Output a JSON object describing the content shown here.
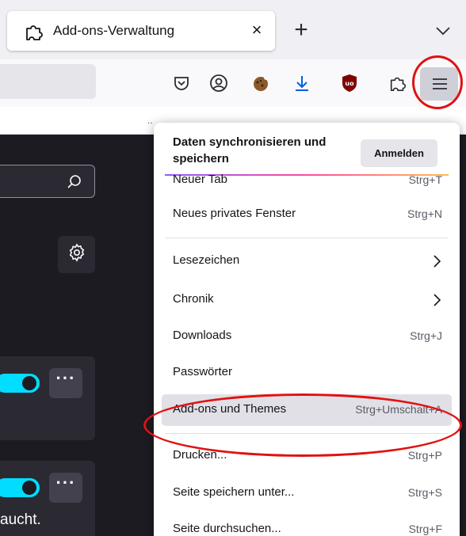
{
  "tab": {
    "title": "Add-ons-Verwaltung",
    "icon": "puzzle-piece-icon",
    "close_symbol": "×"
  },
  "new_tab_symbol": "+",
  "toolbar": {
    "icons": [
      "pocket-icon",
      "account-icon",
      "cookie-extension-icon",
      "downloads-arrow-icon",
      "ublock-shield-icon",
      "extensions-puzzle-icon",
      "hamburger-menu-icon"
    ],
    "bookmarks_overflow": ".."
  },
  "content": {
    "search_icon": "search-icon",
    "gear_icon": "gear-icon",
    "card1": {
      "more": "···"
    },
    "card2": {
      "more": "···",
      "text": "aucht."
    }
  },
  "menu": {
    "sync_title": "Daten synchronisieren und speichern",
    "signin_label": "Anmelden",
    "items": [
      {
        "label": "Neuer Tab",
        "shortcut": "Strg+T"
      },
      {
        "label": "Neues privates Fenster",
        "shortcut": "Strg+N"
      },
      {
        "label": "Lesezeichen",
        "shortcut": ""
      },
      {
        "label": "Chronik",
        "shortcut": ""
      },
      {
        "label": "Downloads",
        "shortcut": "Strg+J"
      },
      {
        "label": "Passwörter",
        "shortcut": ""
      },
      {
        "label": "Add-ons und Themes",
        "shortcut": "Strg+Umschalt+A"
      },
      {
        "label": "Drucken...",
        "shortcut": "Strg+P"
      },
      {
        "label": "Seite speichern unter...",
        "shortcut": "Strg+S"
      },
      {
        "label": "Seite durchsuchen...",
        "shortcut": "Strg+F"
      }
    ]
  },
  "colors": {
    "annotation": "#e01212",
    "toggle_on": "#00ddff",
    "page_bg": "#1c1b22",
    "download_blue": "#0060df",
    "ublock_red": "#800000"
  }
}
